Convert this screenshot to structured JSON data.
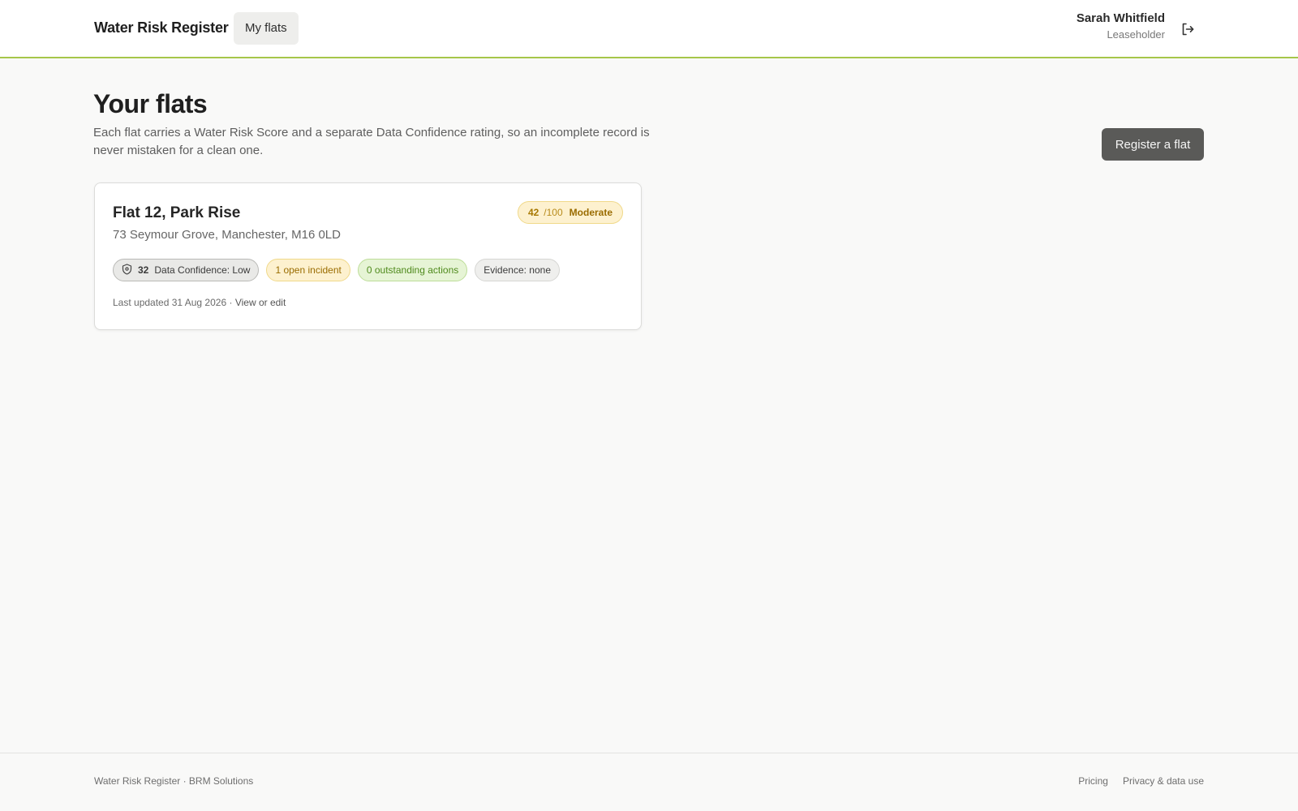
{
  "header": {
    "brand": "Water Risk Register",
    "nav_tab": "My flats",
    "user_name": "Sarah Whitfield",
    "user_role": "Leaseholder",
    "logout_icon": "logout-icon"
  },
  "page": {
    "title": "Your flats",
    "description": "Each flat carries a Water Risk Score and a separate Data Confidence rating, so an incomplete record is never mistaken for a clean one.",
    "register_button": "Register a flat"
  },
  "flats": [
    {
      "name": "Flat 12, Park Rise",
      "address": "73 Seymour Grove, Manchester, M16 0LD",
      "risk_score": "42",
      "risk_max": "/100",
      "risk_level": "Moderate",
      "confidence_score": "32",
      "confidence_label": "Data Confidence: Low",
      "incidents": "1 open incident",
      "actions": "0 outstanding actions",
      "evidence": "Evidence: none",
      "last_updated": "Last updated 31 Aug 2026 ·",
      "edit_link": "View or edit"
    }
  ],
  "footer": {
    "left": "Water Risk Register · BRM Solutions",
    "links": [
      "Pricing",
      "Privacy & data use"
    ]
  },
  "colors": {
    "accent_line": "#a6c64a",
    "moderate": "#a77800",
    "good": "#4f8a1c",
    "primary_button": "#5a5a58"
  }
}
